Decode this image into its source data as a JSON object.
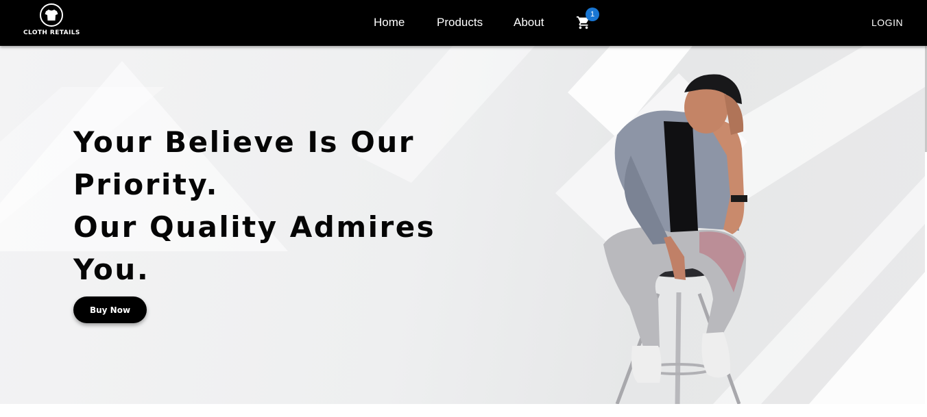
{
  "brand": {
    "name": "CLOTH RETAILS",
    "logo_icon": "tshirt-icon"
  },
  "nav": {
    "links": [
      {
        "label": "Home"
      },
      {
        "label": "Products"
      },
      {
        "label": "About"
      }
    ],
    "cart": {
      "icon": "cart-icon",
      "count": "1"
    },
    "login_label": "LOGIN"
  },
  "hero": {
    "headline_lines": [
      "Your Believe Is Our",
      "Priority.",
      "Our Quality Admires",
      "You."
    ],
    "cta_label": "Buy Now",
    "image": "man-sitting-on-stool-photo"
  },
  "colors": {
    "navbar": "#000000",
    "badge": "#1976d2",
    "button": "#000000",
    "hero_bg": "#eeeff0"
  }
}
